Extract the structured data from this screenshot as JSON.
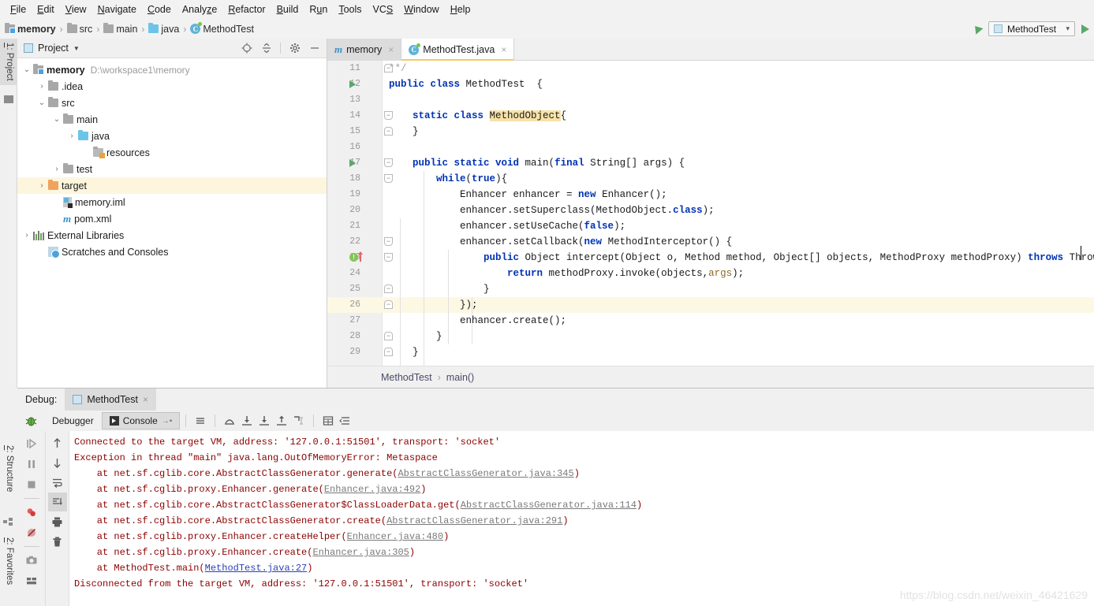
{
  "menu": {
    "items": [
      {
        "label": "File",
        "mnemonic": "F"
      },
      {
        "label": "Edit",
        "mnemonic": "E"
      },
      {
        "label": "View",
        "mnemonic": "V"
      },
      {
        "label": "Navigate",
        "mnemonic": "N"
      },
      {
        "label": "Code",
        "mnemonic": "C"
      },
      {
        "label": "Analyze",
        "mnemonic": "z"
      },
      {
        "label": "Refactor",
        "mnemonic": "R"
      },
      {
        "label": "Build",
        "mnemonic": "B"
      },
      {
        "label": "Run",
        "mnemonic": "u"
      },
      {
        "label": "Tools",
        "mnemonic": "T"
      },
      {
        "label": "VCS",
        "mnemonic": "S"
      },
      {
        "label": "Window",
        "mnemonic": "W"
      },
      {
        "label": "Help",
        "mnemonic": "H"
      }
    ]
  },
  "navbar": {
    "crumbs": [
      {
        "label": "memory",
        "icon": "module-folder-icon"
      },
      {
        "label": "src",
        "icon": "folder-icon"
      },
      {
        "label": "main",
        "icon": "folder-icon"
      },
      {
        "label": "java",
        "icon": "source-folder-icon"
      },
      {
        "label": "MethodTest",
        "icon": "java-class-icon"
      }
    ],
    "separator": "›",
    "run_config": "MethodTest",
    "run_button": "Run",
    "updates_icon": "arrow-up-icon"
  },
  "left_tool_tabs": [
    {
      "label": "1: Project",
      "mnemonic": "1"
    },
    {
      "label": "2: Structure",
      "mnemonic": "2"
    },
    {
      "label": "2: Favorites",
      "mnemonic": "2"
    }
  ],
  "project_panel": {
    "title": "Project",
    "tools": [
      "locate-icon",
      "collapse-all-icon",
      "settings-gear-icon",
      "hide-icon"
    ],
    "tree": [
      {
        "indent": 0,
        "twist": "⌄",
        "label": "memory",
        "bold": true,
        "path": "D:\\workspace1\\memory",
        "icon": "module-folder-icon",
        "selected": false
      },
      {
        "indent": 1,
        "twist": "›",
        "label": ".idea",
        "bold": false,
        "path": "",
        "icon": "folder-icon",
        "selected": false
      },
      {
        "indent": 1,
        "twist": "⌄",
        "label": "src",
        "bold": false,
        "path": "",
        "icon": "folder-icon",
        "selected": false
      },
      {
        "indent": 2,
        "twist": "⌄",
        "label": "main",
        "bold": false,
        "path": "",
        "icon": "folder-icon",
        "selected": false
      },
      {
        "indent": 3,
        "twist": "›",
        "label": "java",
        "bold": false,
        "path": "",
        "icon": "source-folder-icon",
        "selected": false
      },
      {
        "indent": 4,
        "twist": "",
        "label": "resources",
        "bold": false,
        "path": "",
        "icon": "resources-folder-icon",
        "selected": false
      },
      {
        "indent": 2,
        "twist": "›",
        "label": "test",
        "bold": false,
        "path": "",
        "icon": "folder-icon",
        "selected": false
      },
      {
        "indent": 1,
        "twist": "›",
        "label": "target",
        "bold": false,
        "path": "",
        "icon": "excluded-folder-icon",
        "selected": true
      },
      {
        "indent": 2,
        "twist": "",
        "label": "memory.iml",
        "bold": false,
        "path": "",
        "icon": "iml-file-icon",
        "selected": false
      },
      {
        "indent": 2,
        "twist": "",
        "label": "pom.xml",
        "bold": false,
        "path": "",
        "icon": "maven-pom-icon",
        "selected": false
      },
      {
        "indent": 0,
        "twist": "›",
        "label": "External Libraries",
        "bold": false,
        "path": "",
        "icon": "libraries-icon",
        "selected": false
      },
      {
        "indent": 1,
        "twist": "",
        "label": "Scratches and Consoles",
        "bold": false,
        "path": "",
        "icon": "scratches-icon",
        "selected": false
      }
    ]
  },
  "editor": {
    "tabs": [
      {
        "label": "memory",
        "icon": "maven-module-icon",
        "active": false
      },
      {
        "label": "MethodTest.java",
        "icon": "java-class-icon",
        "active": true
      }
    ],
    "close_glyph": "×",
    "breadcrumb": {
      "class": "MethodTest",
      "method": "main()",
      "separator": "›"
    },
    "lines": [
      {
        "n": 11,
        "indent": 1,
        "html": "<span class='cmt'>**/</span>",
        "fold": "end",
        "gutter": "",
        "hl": false
      },
      {
        "n": 12,
        "indent": 0,
        "html": "<span class='kw'>public class</span> MethodTest  {",
        "fold": "",
        "gutter": "run",
        "hl": false
      },
      {
        "n": 13,
        "indent": 0,
        "html": "",
        "fold": "",
        "gutter": "",
        "hl": false
      },
      {
        "n": 14,
        "indent": 1,
        "html": "    <span class='kw'>static class</span> <span class='hlname'>MethodObject</span>{",
        "fold": "start",
        "gutter": "",
        "hl": false
      },
      {
        "n": 15,
        "indent": 1,
        "html": "    }",
        "fold": "end",
        "gutter": "",
        "hl": false
      },
      {
        "n": 16,
        "indent": 0,
        "html": "",
        "fold": "",
        "gutter": "",
        "hl": false
      },
      {
        "n": 17,
        "indent": 1,
        "html": "    <span class='kw'>public static void</span> main(<span class='kw'>final</span> String[] args) {",
        "fold": "start",
        "gutter": "run",
        "hl": false
      },
      {
        "n": 18,
        "indent": 2,
        "html": "        <span class='kw'>while</span>(<span class='kw'>true</span>){",
        "fold": "start",
        "gutter": "",
        "hl": false
      },
      {
        "n": 19,
        "indent": 3,
        "html": "            Enhancer enhancer = <span class='kw'>new</span> Enhancer();",
        "fold": "",
        "gutter": "",
        "hl": false
      },
      {
        "n": 20,
        "indent": 3,
        "html": "            enhancer.setSuperclass(MethodObject.<span class='kw'>class</span>);",
        "fold": "",
        "gutter": "",
        "hl": false
      },
      {
        "n": 21,
        "indent": 3,
        "html": "            enhancer.setUseCache(<span class='kw'>false</span>);",
        "fold": "",
        "gutter": "",
        "hl": false
      },
      {
        "n": 22,
        "indent": 3,
        "html": "            enhancer.setCallback(<span class='kw'>new</span> MethodInterceptor() {",
        "fold": "start",
        "gutter": "",
        "hl": false
      },
      {
        "n": 23,
        "indent": 4,
        "html": "                <span class='kw'>public</span> Object intercept(Object o, Method method, Object[] objects, MethodProxy methodProxy) <span class='kw'>throws</span> Throwable {",
        "fold": "start",
        "gutter": "breakpoint",
        "hl": false
      },
      {
        "n": 24,
        "indent": 5,
        "html": "                    <span class='kw'>return</span> methodProxy.invoke(objects,<span class='param'>args</span>);",
        "fold": "",
        "gutter": "",
        "hl": false
      },
      {
        "n": 25,
        "indent": 4,
        "html": "                }",
        "fold": "end",
        "gutter": "",
        "hl": false
      },
      {
        "n": 26,
        "indent": 3,
        "html": "            });",
        "fold": "end",
        "gutter": "",
        "hl": true
      },
      {
        "n": 27,
        "indent": 3,
        "html": "            enhancer.create();",
        "fold": "",
        "gutter": "",
        "hl": false
      },
      {
        "n": 28,
        "indent": 2,
        "html": "        }",
        "fold": "end",
        "gutter": "",
        "hl": false
      },
      {
        "n": 29,
        "indent": 1,
        "html": "    }",
        "fold": "end",
        "gutter": "",
        "hl": false
      }
    ]
  },
  "debug": {
    "panel_label": "Debug:",
    "session_tab": "MethodTest",
    "close_glyph": "×",
    "tabs": [
      {
        "label": "Debugger",
        "active": false
      },
      {
        "label": "Console",
        "active": true
      }
    ],
    "console_soft_wrap_glyph": "→▪",
    "toolbar_icons": [
      "bug-icon",
      "menu-icon",
      "step-over-icon",
      "step-into-icon",
      "force-step-into-icon",
      "step-out-icon",
      "run-to-cursor-icon",
      "evaluate-icon",
      "layout-icon"
    ],
    "side_icons": [
      "resume-icon",
      "pause-icon",
      "stop-icon",
      "view-breakpoints-icon",
      "mute-breakpoints-icon",
      "settings-camera-icon",
      "layout-settings-icon"
    ],
    "console_side_icons": [
      "scroll-up-icon",
      "scroll-down-icon",
      "soft-wrap-icon",
      "scroll-to-end-icon",
      "print-icon",
      "clear-all-icon"
    ],
    "console_lines": [
      {
        "text": "Connected to the target VM, address: '127.0.0.1:51501', transport: 'socket'",
        "links": []
      },
      {
        "text": "Exception in thread \"main\" java.lang.OutOfMemoryError: Metaspace",
        "links": []
      },
      {
        "text": "    at net.sf.cglib.core.AbstractClassGenerator.generate(AbstractClassGenerator.java:345)",
        "link": "AbstractClassGenerator.java:345",
        "link_style": "gray"
      },
      {
        "text": "    at net.sf.cglib.proxy.Enhancer.generate(Enhancer.java:492)",
        "link": "Enhancer.java:492",
        "link_style": "gray"
      },
      {
        "text": "    at net.sf.cglib.core.AbstractClassGenerator$ClassLoaderData.get(AbstractClassGenerator.java:114)",
        "link": "AbstractClassGenerator.java:114",
        "link_style": "gray"
      },
      {
        "text": "    at net.sf.cglib.core.AbstractClassGenerator.create(AbstractClassGenerator.java:291)",
        "link": "AbstractClassGenerator.java:291",
        "link_style": "gray"
      },
      {
        "text": "    at net.sf.cglib.proxy.Enhancer.createHelper(Enhancer.java:480)",
        "link": "Enhancer.java:480",
        "link_style": "gray"
      },
      {
        "text": "    at net.sf.cglib.proxy.Enhancer.create(Enhancer.java:305)",
        "link": "Enhancer.java:305",
        "link_style": "gray"
      },
      {
        "text": "    at MethodTest.main(MethodTest.java:27)",
        "link": "MethodTest.java:27",
        "link_style": "blue"
      },
      {
        "text": "Disconnected from the target VM, address: '127.0.0.1:51501', transport: 'socket'",
        "links": []
      }
    ]
  },
  "watermark": "https://blog.csdn.net/weixin_46421629",
  "colors": {
    "accent_blue": "#0033b3",
    "error_red": "#8b0000",
    "selection_yellow": "#fdf6dd",
    "highlight_line": "#fdf8e3",
    "run_green": "#59a869",
    "panel_gray": "#f0f0f0"
  }
}
